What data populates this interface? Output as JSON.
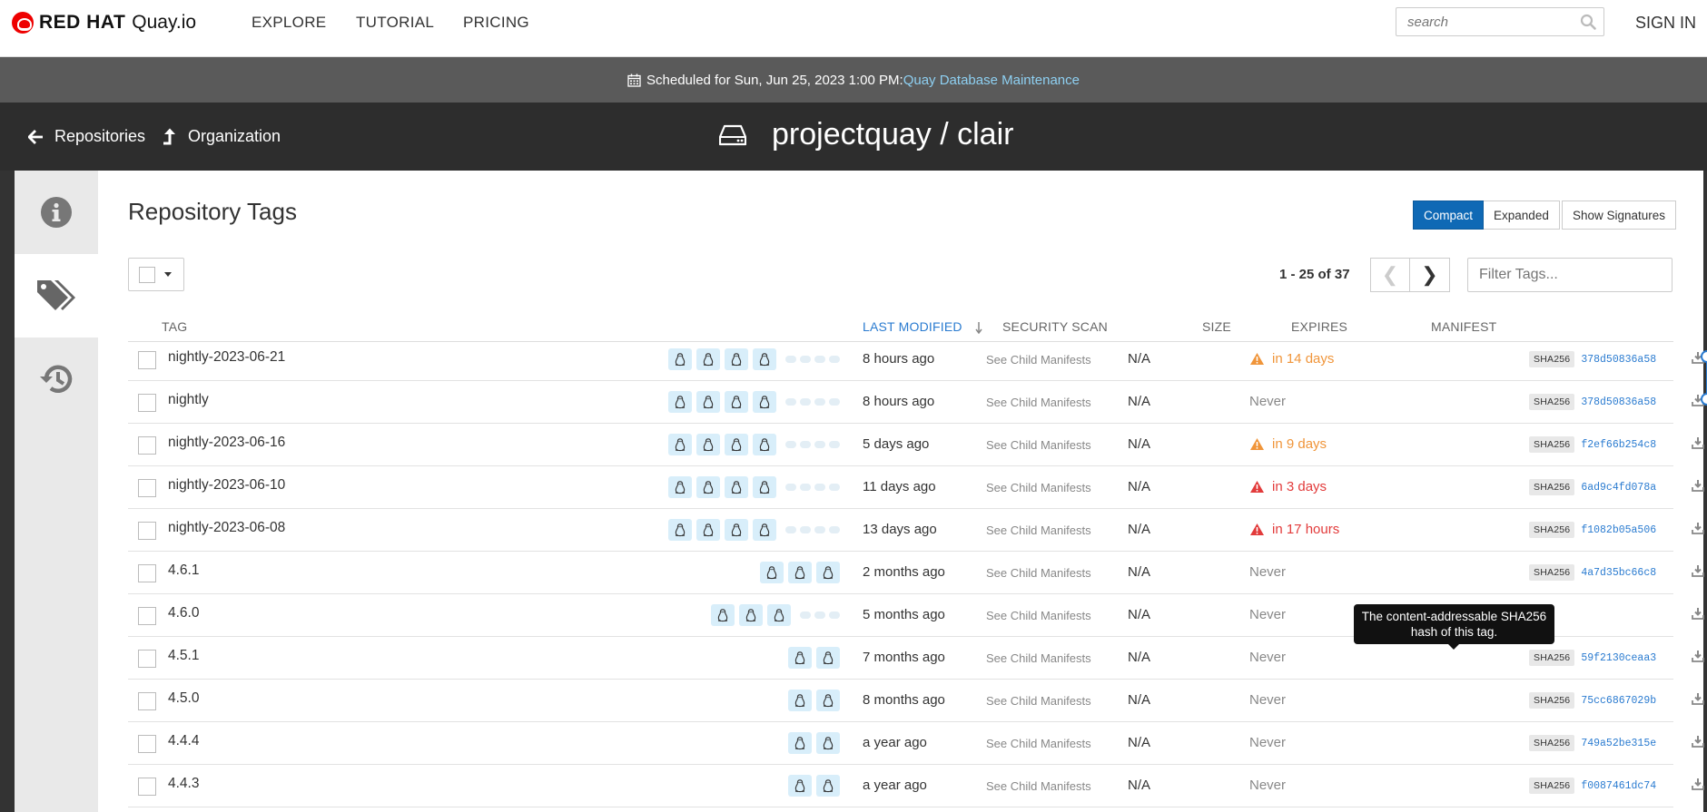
{
  "nav": {
    "brand": "RED HAT",
    "product": "Quay.io",
    "links": [
      "EXPLORE",
      "TUTORIAL",
      "PRICING"
    ],
    "search_placeholder": "search",
    "signin": "SIGN IN"
  },
  "banner": {
    "text": "Scheduled for Sun, Jun 25, 2023 1:00 PM:",
    "link": "Quay Database Maintenance"
  },
  "header": {
    "back_link": "Repositories",
    "org_link": "Organization",
    "repo_title": "projectquay / clair"
  },
  "main": {
    "title": "Repository Tags",
    "view_buttons": [
      "Compact",
      "Expanded",
      "Show Signatures"
    ],
    "pager_text": "1 - 25 of 37",
    "filter_placeholder": "Filter Tags...",
    "columns": [
      "TAG",
      "LAST MODIFIED",
      "SECURITY SCAN",
      "SIZE",
      "EXPIRES",
      "MANIFEST"
    ],
    "tooltip": "The content-addressable SHA256 hash of this tag."
  },
  "tags": [
    {
      "name": "nightly-2023-06-21",
      "archs": 4,
      "dots": 4,
      "modified": "8 hours ago",
      "scan": "See Child Manifests",
      "size": "N/A",
      "expires": "in 14 days",
      "exp_level": "warn",
      "sha": "SHA256",
      "digest": "378d50836a58"
    },
    {
      "name": "nightly",
      "archs": 4,
      "dots": 4,
      "modified": "8 hours ago",
      "scan": "See Child Manifests",
      "size": "N/A",
      "expires": "Never",
      "exp_level": "never",
      "sha": "SHA256",
      "digest": "378d50836a58"
    },
    {
      "name": "nightly-2023-06-16",
      "archs": 4,
      "dots": 4,
      "modified": "5 days ago",
      "scan": "See Child Manifests",
      "size": "N/A",
      "expires": "in 9 days",
      "exp_level": "warn",
      "sha": "SHA256",
      "digest": "f2ef66b254c8"
    },
    {
      "name": "nightly-2023-06-10",
      "archs": 4,
      "dots": 4,
      "modified": "11 days ago",
      "scan": "See Child Manifests",
      "size": "N/A",
      "expires": "in 3 days",
      "exp_level": "crit",
      "sha": "SHA256",
      "digest": "6ad9c4fd078a"
    },
    {
      "name": "nightly-2023-06-08",
      "archs": 4,
      "dots": 4,
      "modified": "13 days ago",
      "scan": "See Child Manifests",
      "size": "N/A",
      "expires": "in 17 hours",
      "exp_level": "crit",
      "sha": "SHA256",
      "digest": "f1082b05a506"
    },
    {
      "name": "4.6.1",
      "archs": 3,
      "dots": 0,
      "modified": "2 months ago",
      "scan": "See Child Manifests",
      "size": "N/A",
      "expires": "Never",
      "exp_level": "never",
      "sha": "SHA256",
      "digest": "4a7d35bc66c8"
    },
    {
      "name": "4.6.0",
      "archs": 3,
      "dots": 3,
      "modified": "5 months ago",
      "scan": "See Child Manifests",
      "size": "N/A",
      "expires": "Never",
      "exp_level": "never",
      "sha": "",
      "digest": ""
    },
    {
      "name": "4.5.1",
      "archs": 2,
      "dots": 0,
      "modified": "7 months ago",
      "scan": "See Child Manifests",
      "size": "N/A",
      "expires": "Never",
      "exp_level": "never",
      "sha": "SHA256",
      "digest": "59f2130ceaa3"
    },
    {
      "name": "4.5.0",
      "archs": 2,
      "dots": 0,
      "modified": "8 months ago",
      "scan": "See Child Manifests",
      "size": "N/A",
      "expires": "Never",
      "exp_level": "never",
      "sha": "SHA256",
      "digest": "75cc6867029b"
    },
    {
      "name": "4.4.4",
      "archs": 2,
      "dots": 0,
      "modified": "a year ago",
      "scan": "See Child Manifests",
      "size": "N/A",
      "expires": "Never",
      "exp_level": "never",
      "sha": "SHA256",
      "digest": "749a52be315e"
    },
    {
      "name": "4.4.3",
      "archs": 2,
      "dots": 0,
      "modified": "a year ago",
      "scan": "See Child Manifests",
      "size": "N/A",
      "expires": "Never",
      "exp_level": "never",
      "sha": "SHA256",
      "digest": "f0087461dc74"
    }
  ],
  "colors": {
    "primary": "#0f69b5",
    "warn": "#f0953a",
    "crit": "#e23b3b",
    "link": "#2a7bd0"
  }
}
